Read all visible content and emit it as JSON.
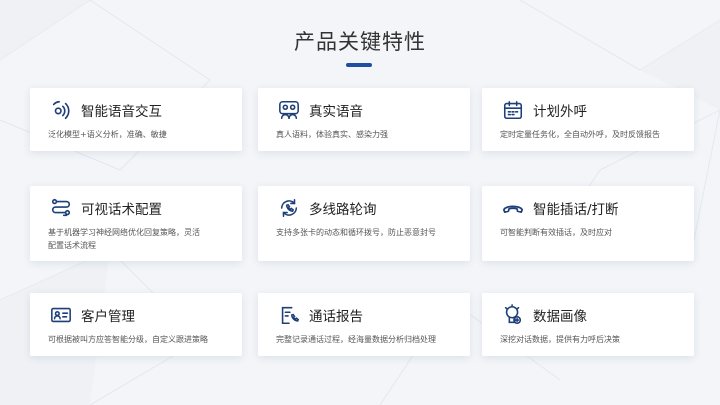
{
  "page": {
    "title": "产品关键特性"
  },
  "features": [
    {
      "title": "智能语音交互",
      "desc": "泛化模型+语义分析，准确、敏捷",
      "icon": "voice-wave-icon"
    },
    {
      "title": "真实语音",
      "desc": "真人语料，体验真实、感染力强",
      "icon": "people-chat-icon"
    },
    {
      "title": "计划外呼",
      "desc": "定时定量任务化，全自动外呼，及时反馈报告",
      "icon": "calendar-icon"
    },
    {
      "title": "可视话术配置",
      "desc": "基于机器学习神经网络优化回复策略，灵活配置话术流程",
      "icon": "flow-icon"
    },
    {
      "title": "多线路轮询",
      "desc": "支持多张卡的动态和循环拨号，防止恶意封号",
      "icon": "phone-cycle-icon"
    },
    {
      "title": "智能插话/打断",
      "desc": "可智能判断有效插话，及时应对",
      "icon": "hangup-icon"
    },
    {
      "title": "客户管理",
      "desc": "可根据被叫方应答智能分级，自定义跟进策略",
      "icon": "id-card-icon"
    },
    {
      "title": "通话报告",
      "desc": "完整记录通话过程，经海量数据分析归档处理",
      "icon": "report-phone-icon"
    },
    {
      "title": "数据画像",
      "desc": "深挖对话数据，提供有力呼后决策",
      "icon": "user-profile-icon"
    }
  ],
  "colors": {
    "accent": "#1f4fa0",
    "icon": "#1f3f7a"
  }
}
